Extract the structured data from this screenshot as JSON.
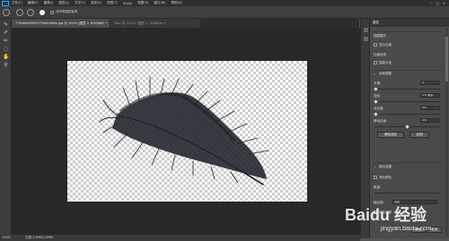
{
  "menu": {
    "items": [
      "文件(F)",
      "编辑(E)",
      "图像(I)",
      "图层(L)",
      "文字(Y)",
      "选择(S)",
      "滤镜(T)",
      "3D(D)",
      "视图(V)",
      "窗口(W)",
      "帮助(H)"
    ]
  },
  "options": {
    "sample_all_layers": "对所有图层取样"
  },
  "tabs": [
    {
      "label": "778469d54953754614b9b.jpg @ 100% (图层 0, RGB/8#) *"
    },
    {
      "label": "Twin @ 33.3% (图层 1, RGB/8#) *"
    }
  ],
  "panel": {
    "title": "属性",
    "mode_label": "视图模式",
    "show_edges": "显示边缘",
    "edge_detection": "边缘检测",
    "smart_radius": "智能半径",
    "global_refine": "全局调整",
    "smooth_label": "平滑:",
    "smooth_value": "0",
    "feather_label": "羽化:",
    "feather_value": "0.0 像素",
    "contrast_label": "对比度:",
    "contrast_value": "0%",
    "shift_edge_label": "移动边缘:",
    "shift_edge_value": "0%",
    "clear_button": "清除选区",
    "invert_button": "反相",
    "output_settings": "输出设置",
    "decontaminate": "净化颜色",
    "amount_label": "数量:",
    "output_to": "输出到:",
    "output_value": "选区",
    "remember": "记住设置",
    "ok": "确定",
    "cancel": "取消"
  },
  "status": {
    "zoom": "100%",
    "doc_size": "文档:1.89M/1.89M"
  },
  "watermark": {
    "text": "Baidu 经验",
    "url": "jingyan.baidu.com"
  },
  "colors": {
    "accent": "#31a8ff",
    "canvas_bg": "#282828",
    "feather": "#1d2129"
  }
}
